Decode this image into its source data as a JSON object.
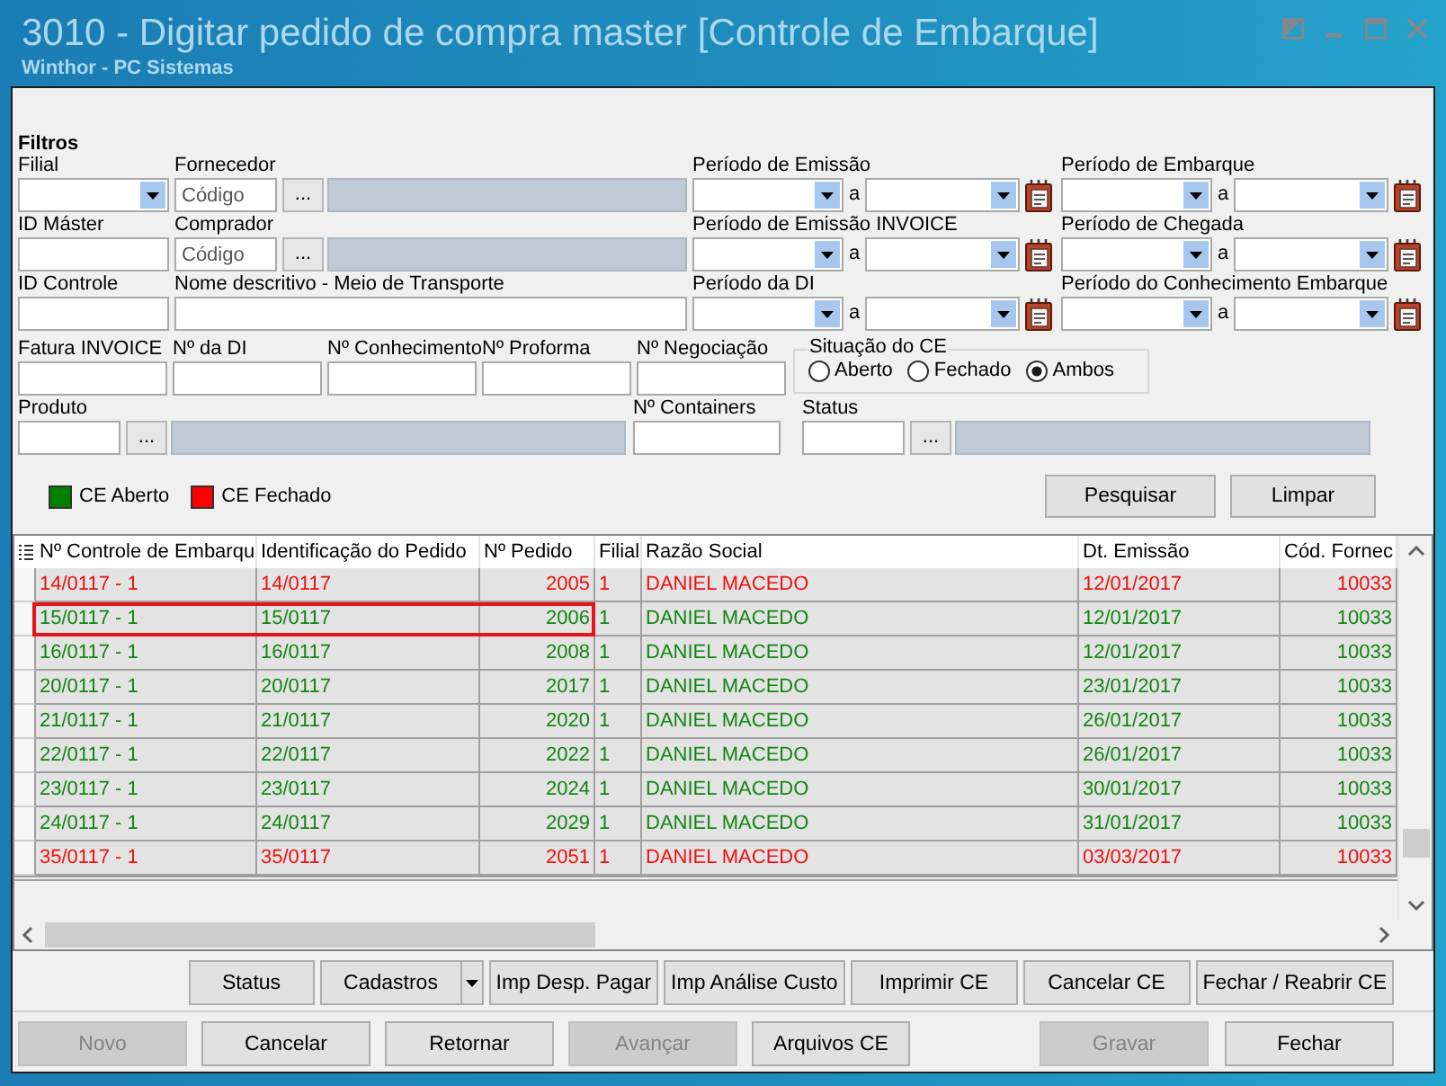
{
  "window": {
    "title": "3010 - Digitar pedido de compra master [Controle de Embarque]",
    "subtitle": "Winthor - PC Sistemas"
  },
  "filters": {
    "heading": "Filtros",
    "rows": [
      {
        "fields": [
          {
            "kind": "combo",
            "label": "Filial"
          },
          {
            "kind": "lookup",
            "label": "Fornecedor",
            "placeholder": "Código",
            "button": "..."
          },
          {
            "kind": "date_range",
            "label": "Período de Emissão",
            "separator": "a"
          },
          {
            "kind": "date_range",
            "label": "Período de Embarque",
            "separator": "a"
          }
        ]
      },
      {
        "fields": [
          {
            "kind": "text",
            "label": "ID Máster"
          },
          {
            "kind": "lookup",
            "label": "Comprador",
            "placeholder": "Código",
            "button": "..."
          },
          {
            "kind": "date_range",
            "label": "Período de Emissão INVOICE",
            "separator": "a"
          },
          {
            "kind": "date_range",
            "label": "Período de Chegada",
            "separator": "a"
          }
        ]
      },
      {
        "fields": [
          {
            "kind": "text",
            "label": "ID Controle"
          },
          {
            "kind": "text",
            "label": "Nome descritivo - Meio de Transporte"
          },
          {
            "kind": "date_range",
            "label": "Período da DI",
            "separator": "a"
          },
          {
            "kind": "date_range",
            "label": "Período do Conhecimento Embarque",
            "separator": "a"
          }
        ]
      },
      {
        "fields": [
          {
            "kind": "text",
            "label": "Fatura INVOICE"
          },
          {
            "kind": "text",
            "label": "Nº da DI"
          },
          {
            "kind": "text",
            "label": "Nº Conhecimento"
          },
          {
            "kind": "text",
            "label": "Nº Proforma"
          },
          {
            "kind": "text",
            "label": "Nº Negociação"
          },
          {
            "kind": "radio_group",
            "label": "Situação do CE",
            "options": [
              {
                "label": "Aberto",
                "selected": false
              },
              {
                "label": "Fechado",
                "selected": false
              },
              {
                "label": "Ambos",
                "selected": true
              }
            ]
          }
        ]
      },
      {
        "fields": [
          {
            "kind": "lookup",
            "label": "Produto",
            "button": "..."
          },
          {
            "kind": "text",
            "label": "Nº Containers"
          },
          {
            "kind": "lookup",
            "label": "Status",
            "button": "..."
          }
        ]
      }
    ]
  },
  "legend": [
    {
      "label": "CE Aberto",
      "color": "#008000"
    },
    {
      "label": "CE Fechado",
      "color": "#ff0000"
    }
  ],
  "search_buttons": [
    {
      "label": "Pesquisar"
    },
    {
      "label": "Limpar"
    }
  ],
  "table": {
    "columns": [
      "Nº Controle de Embarqu",
      "Identificação do Pedido",
      "Nº Pedido",
      "Filial",
      "Razão Social",
      "Dt. Emissão",
      "Cód. Fornec"
    ],
    "rows": [
      {
        "cells": [
          "14/0117 - 1",
          "14/0117",
          "2005",
          "1",
          "DANIEL MACEDO",
          "12/01/2017",
          "10033"
        ],
        "closed": true,
        "highlighted": false
      },
      {
        "cells": [
          "15/0117 - 1",
          "15/0117",
          "2006",
          "1",
          "DANIEL MACEDO",
          "12/01/2017",
          "10033"
        ],
        "closed": false,
        "highlighted": true
      },
      {
        "cells": [
          "16/0117 - 1",
          "16/0117",
          "2008",
          "1",
          "DANIEL MACEDO",
          "12/01/2017",
          "10033"
        ],
        "closed": false,
        "highlighted": false
      },
      {
        "cells": [
          "20/0117 - 1",
          "20/0117",
          "2017",
          "1",
          "DANIEL MACEDO",
          "23/01/2017",
          "10033"
        ],
        "closed": false,
        "highlighted": false
      },
      {
        "cells": [
          "21/0117 - 1",
          "21/0117",
          "2020",
          "1",
          "DANIEL MACEDO",
          "26/01/2017",
          "10033"
        ],
        "closed": false,
        "highlighted": false
      },
      {
        "cells": [
          "22/0117 - 1",
          "22/0117",
          "2022",
          "1",
          "DANIEL MACEDO",
          "26/01/2017",
          "10033"
        ],
        "closed": false,
        "highlighted": false
      },
      {
        "cells": [
          "23/0117 - 1",
          "23/0117",
          "2024",
          "1",
          "DANIEL MACEDO",
          "30/01/2017",
          "10033"
        ],
        "closed": false,
        "highlighted": false
      },
      {
        "cells": [
          "24/0117 - 1",
          "24/0117",
          "2029",
          "1",
          "DANIEL MACEDO",
          "31/01/2017",
          "10033"
        ],
        "closed": false,
        "highlighted": false
      },
      {
        "cells": [
          "35/0117 - 1",
          "35/0117",
          "2051",
          "1",
          "DANIEL MACEDO",
          "03/03/2017",
          "10033"
        ],
        "closed": true,
        "highlighted": false
      }
    ]
  },
  "action_buttons": [
    {
      "label": "Status",
      "kind": "plain"
    },
    {
      "label": "Cadastros",
      "kind": "split"
    },
    {
      "label": "Imp Desp. Pagar",
      "kind": "plain"
    },
    {
      "label": "Imp Análise Custo",
      "kind": "plain"
    },
    {
      "label": "Imprimir CE",
      "kind": "plain"
    },
    {
      "label": "Cancelar CE",
      "kind": "plain"
    },
    {
      "label": "Fechar / Reabrir CE",
      "kind": "plain"
    }
  ],
  "footer": {
    "buttons": [
      {
        "label": "Novo",
        "disabled": true
      },
      {
        "label": "Cancelar",
        "disabled": false
      },
      {
        "label": "Retornar",
        "disabled": false
      },
      {
        "label": "Avançar",
        "disabled": true
      },
      {
        "label": "Arquivos CE",
        "disabled": false
      }
    ],
    "end_buttons": [
      {
        "label": "Gravar",
        "disabled": true
      },
      {
        "label": "Fechar",
        "disabled": false
      }
    ]
  }
}
